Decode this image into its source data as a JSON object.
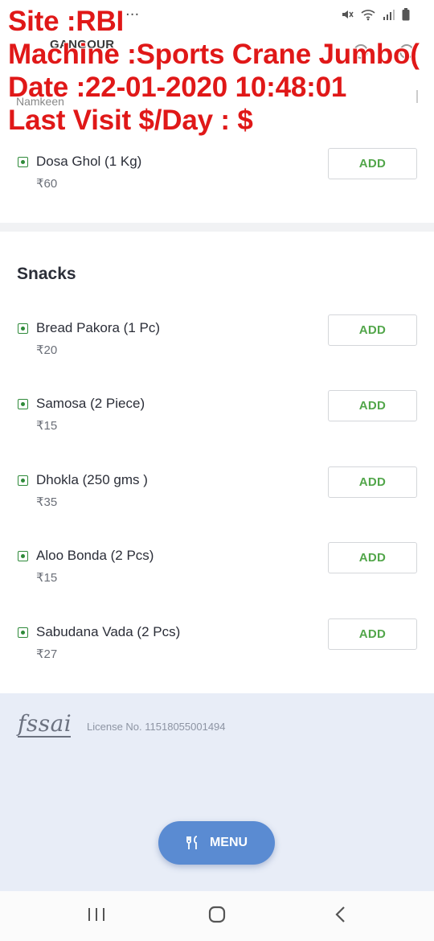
{
  "overlay": {
    "site": "Site :RBI",
    "machine": "Machine :Sports Crane Jumbo(",
    "date": "Date :22-01-2020 10:48:01",
    "last_visit": "Last Visit $/Day : $"
  },
  "status_bar": {
    "dots": "···"
  },
  "header": {
    "title": "GANGOUR"
  },
  "subheader": {
    "category": "Namkeen"
  },
  "items_top": [
    {
      "name": "Dosa Ghol (1 Kg)",
      "price": "₹60",
      "add_label": "ADD"
    }
  ],
  "snacks": {
    "title": "Snacks",
    "items": [
      {
        "name": "Bread Pakora (1 Pc)",
        "price": "₹20",
        "add_label": "ADD"
      },
      {
        "name": "Samosa (2 Piece)",
        "price": "₹15",
        "add_label": "ADD"
      },
      {
        "name": "Dhokla (250 gms )",
        "price": "₹35",
        "add_label": "ADD"
      },
      {
        "name": "Aloo Bonda (2 Pcs)",
        "price": "₹15",
        "add_label": "ADD"
      },
      {
        "name": "Sabudana Vada (2 Pcs)",
        "price": "₹27",
        "add_label": "ADD"
      }
    ]
  },
  "footer": {
    "logo_text": "fssai",
    "license": "License No. 11518055001494",
    "menu_label": "MENU",
    "menu_icon": "fork-knife-icon"
  },
  "colors": {
    "add_green": "#52a64a",
    "veg_green": "#2f8a3a",
    "menu_blue": "#5a8bd2",
    "footer_bg": "#e8edf7",
    "overlay_red": "#e01818"
  }
}
